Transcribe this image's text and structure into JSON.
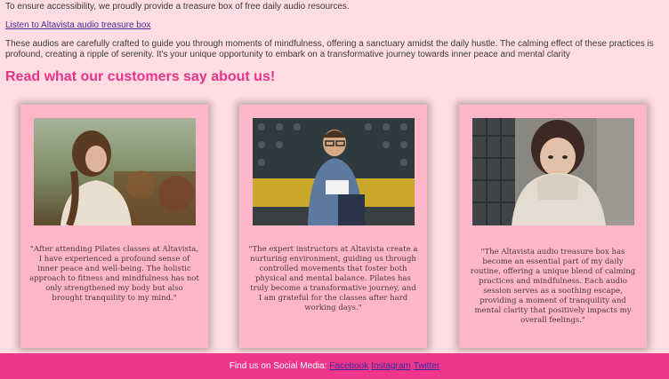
{
  "intro_text": "To ensure accessibility, we proudly provide a treasure box of free daily audio resources.",
  "audio_link_label": "Listen to Altavista audio treasure box",
  "description": "These audios are carefully crafted to guide you through moments of mindfulness, offering a sanctuary amidst the daily hustle. The calming effect of these practices is profound, creating a ripple of serenity. It's your unique opportunity to embark on a transformative journey towards inner peace and mental clarity",
  "testimonials_heading": "Read what our customers say about us!",
  "testimonials": [
    {
      "quote": "\"After attending Pilates classes at Altavista, I have experienced a profound sense of inner peace and well-being. The holistic approach to fitness and mindfulness has not only strengthened my body but also brought tranquility to my mind.\""
    },
    {
      "quote": "\"The expert instructors at Altavista create a nurturing environment, guiding us through controlled movements that foster both physical and mental balance. Pilates has truly become a transformative journey, and I am grateful for the classes after hard working days.\""
    },
    {
      "quote": "\"The Altavista audio treasure box has become an essential part of my daily routine, offering a unique blend of calming practices and mindfulness. Each audio session serves as a soothing escape, providing a moment of tranquility and mental clarity that positively impacts my overall feelings.\""
    }
  ],
  "footer": {
    "label": "Find us on Social Media:",
    "links": [
      "Facebook",
      "Instagram",
      "Twitter"
    ]
  },
  "colors": {
    "page_background": "#ffdde3",
    "heading": "#e8338a",
    "card_background": "#ffb6c8",
    "footer_background": "#f0368a"
  }
}
